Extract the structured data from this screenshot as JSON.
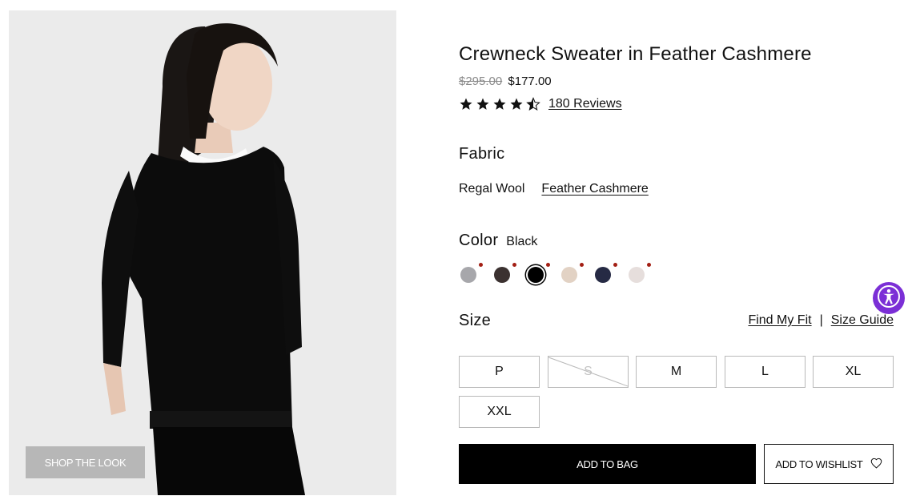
{
  "product": {
    "title": "Crewneck Sweater in Feather Cashmere",
    "price_original": "$295.00",
    "price_sale": "$177.00",
    "rating": 4.5,
    "reviews_label": "180 Reviews"
  },
  "image": {
    "alt": "Model wearing black crewneck sweater",
    "shop_the_look": "SHOP THE LOOK"
  },
  "fabric": {
    "label": "Fabric",
    "options": [
      {
        "label": "Regal Wool",
        "selected": false
      },
      {
        "label": "Feather Cashmere",
        "selected": true
      }
    ]
  },
  "color": {
    "label": "Color",
    "selected_name": "Black",
    "swatches": [
      {
        "name": "grey",
        "hex": "#a7a7ab",
        "selected": false
      },
      {
        "name": "dark-brown",
        "hex": "#3b3130",
        "selected": false
      },
      {
        "name": "black",
        "hex": "#000000",
        "selected": true
      },
      {
        "name": "beige",
        "hex": "#e2d2c4",
        "selected": false
      },
      {
        "name": "navy",
        "hex": "#262a44",
        "selected": false
      },
      {
        "name": "light-pink",
        "hex": "#e6dedc",
        "selected": false
      }
    ],
    "badge_color": "#a31f14"
  },
  "size": {
    "label": "Size",
    "find_my_fit": "Find My Fit",
    "separator": "|",
    "size_guide": "Size Guide",
    "options": [
      {
        "label": "P",
        "available": true
      },
      {
        "label": "S",
        "available": false
      },
      {
        "label": "M",
        "available": true
      },
      {
        "label": "L",
        "available": true
      },
      {
        "label": "XL",
        "available": true
      },
      {
        "label": "XXL",
        "available": true
      }
    ]
  },
  "actions": {
    "add_to_bag": "ADD TO BAG",
    "add_to_wishlist": "ADD TO WISHLIST"
  },
  "accessibility": {
    "icon": "accessibility-icon",
    "color": "#7b2fd6"
  }
}
